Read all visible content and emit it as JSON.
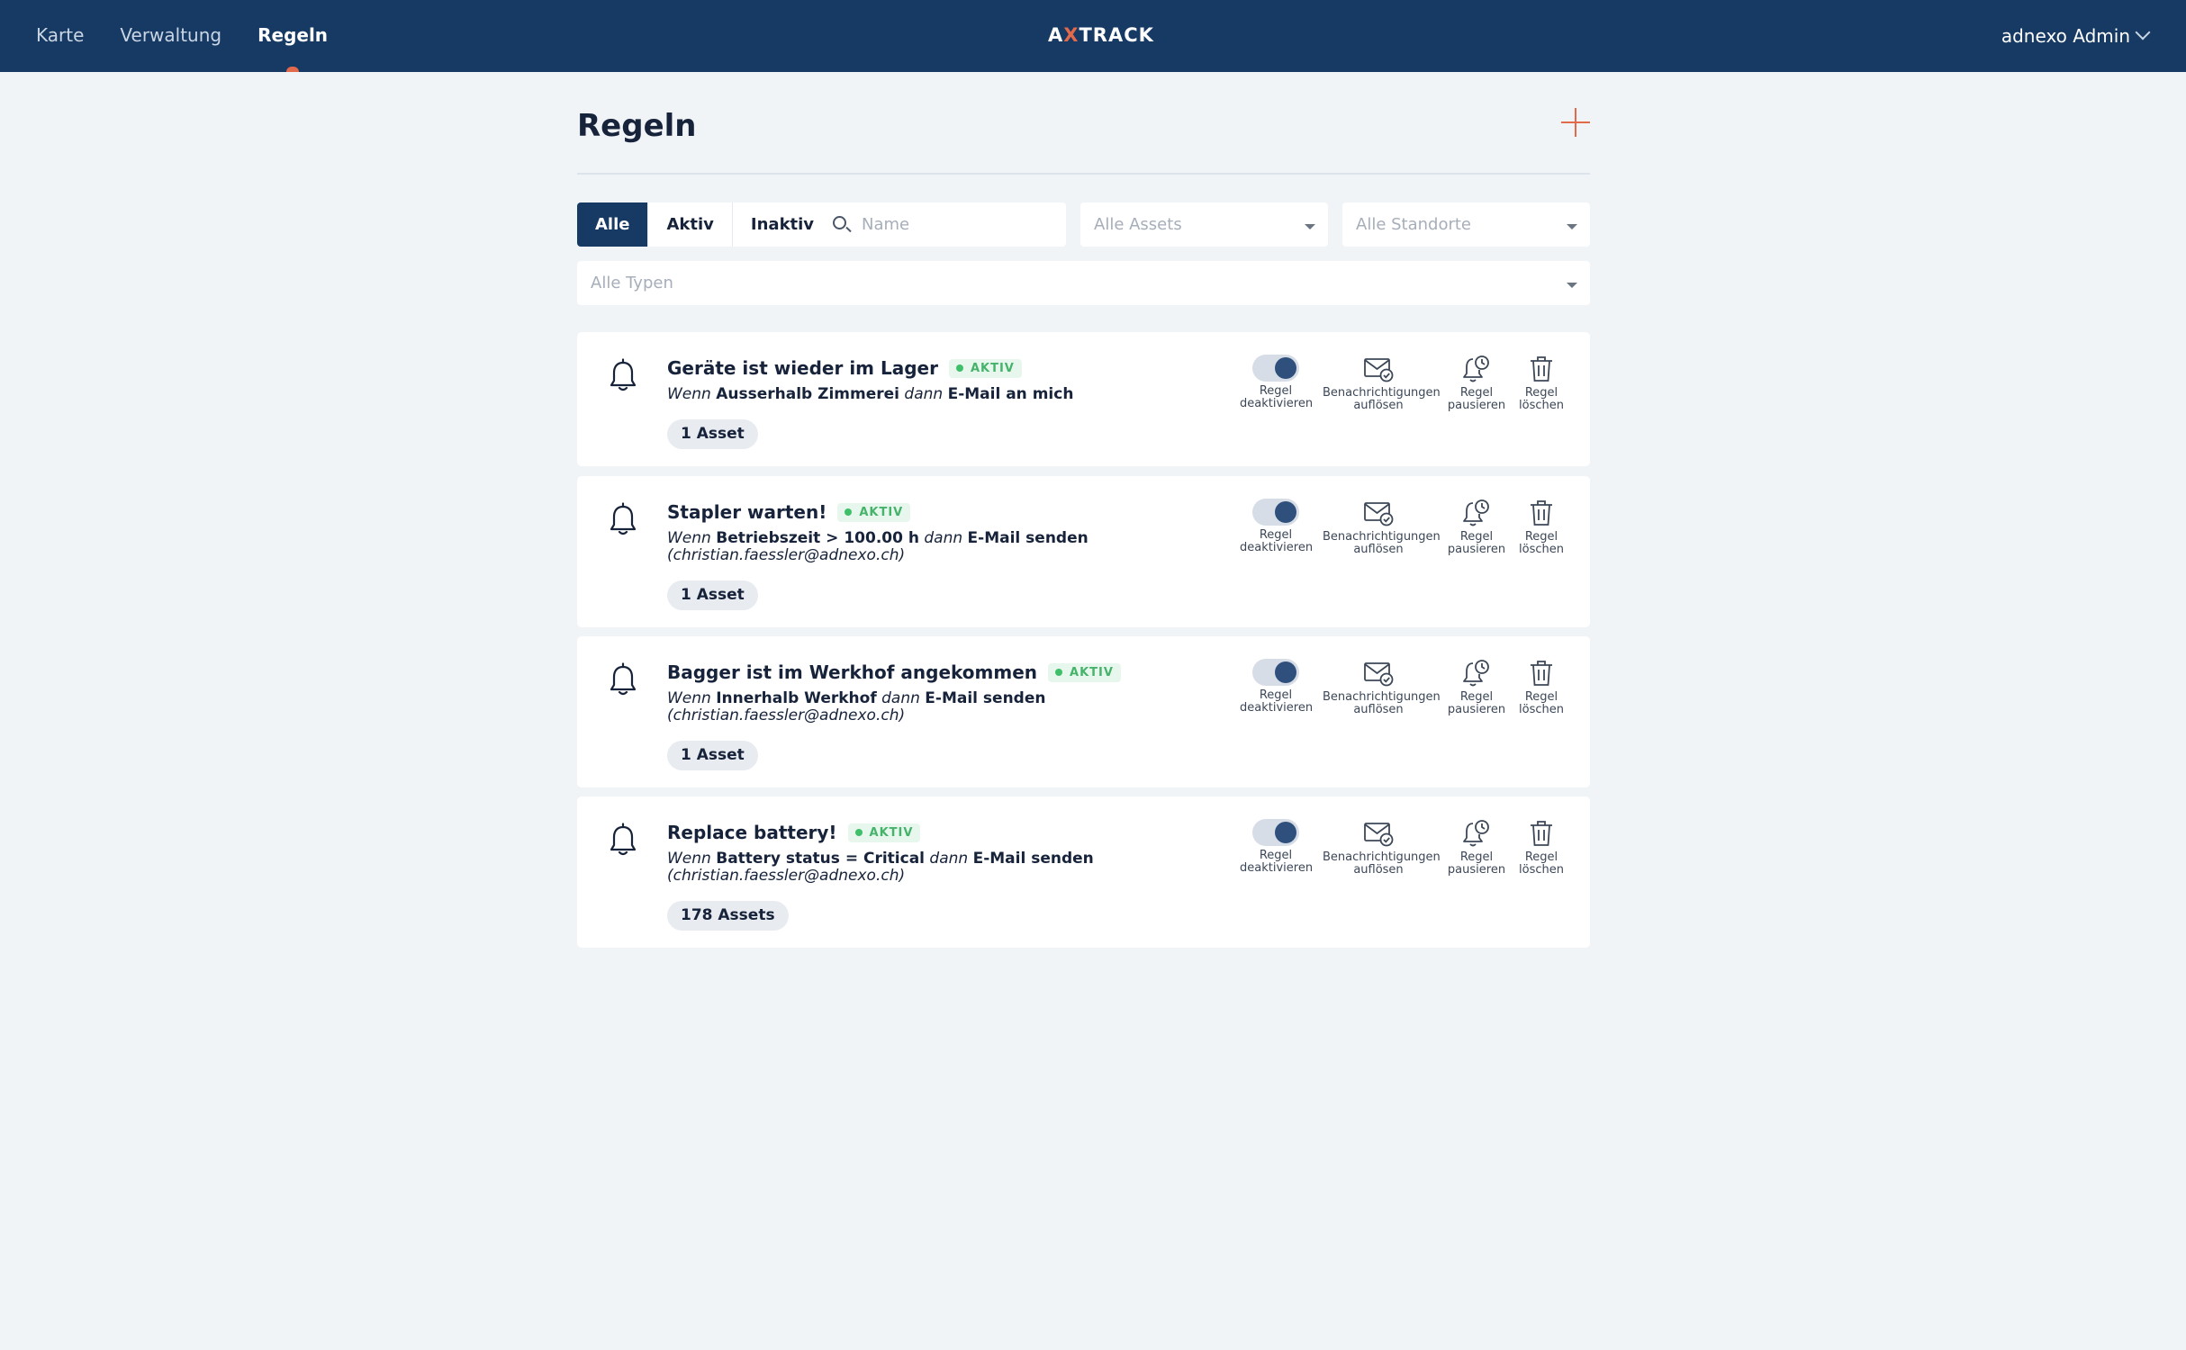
{
  "nav": {
    "items": [
      {
        "label": "Karte",
        "active": false
      },
      {
        "label": "Verwaltung",
        "active": false
      },
      {
        "label": "Regeln",
        "active": true
      }
    ],
    "logo": {
      "part1": "A",
      "part2": "X",
      "part3": "TRACK"
    },
    "user_label": "adnexo Admin"
  },
  "page": {
    "title": "Regeln",
    "filters": {
      "segments": [
        "Alle",
        "Aktiv",
        "Inaktiv"
      ],
      "active_segment": "Alle",
      "search_placeholder": "Name",
      "assets_placeholder": "Alle Assets",
      "standorte_placeholder": "Alle Standorte",
      "typen_placeholder": "Alle Typen"
    }
  },
  "rules": [
    {
      "name": "Geräte ist wieder im Lager",
      "status": "AKTIV",
      "wenn": "Wenn",
      "condition": "Ausserhalb Zimmerei",
      "dann": "dann",
      "action": "E-Mail an mich",
      "recipient": "",
      "assets": "1 Asset"
    },
    {
      "name": "Stapler warten!",
      "status": "AKTIV",
      "wenn": "Wenn",
      "condition": "Betriebszeit > 100.00 h",
      "dann": "dann",
      "action": "E-Mail senden",
      "recipient": "(christian.faessler@adnexo.ch)",
      "assets": "1 Asset"
    },
    {
      "name": "Bagger ist im Werkhof angekommen",
      "status": "AKTIV",
      "wenn": "Wenn",
      "condition": "Innerhalb Werkhof",
      "dann": "dann",
      "action": "E-Mail senden",
      "recipient": "(christian.faessler@adnexo.ch)",
      "assets": "1 Asset"
    },
    {
      "name": "Replace battery!",
      "status": "AKTIV",
      "wenn": "Wenn",
      "condition": "Battery status = Critical",
      "dann": "dann",
      "action": "E-Mail senden",
      "recipient": "(christian.faessler@adnexo.ch)",
      "assets": "178 Assets"
    }
  ],
  "actions": {
    "deactivate": {
      "line1": "Regel",
      "line2": "deaktivieren",
      "icon": "toggle-on-icon"
    },
    "resolve": {
      "line1": "Benachrichtigungen",
      "line2": "auflösen",
      "icon": "mail-check-icon"
    },
    "pause": {
      "line1": "Regel",
      "line2": "pausieren",
      "icon": "bell-clock-icon"
    },
    "delete": {
      "line1": "Regel",
      "line2": "löschen",
      "icon": "trash-icon"
    }
  },
  "colors": {
    "nav_bg": "#163a63",
    "accent": "#e26a4b",
    "status_green": "#3fbf6a",
    "page_bg": "#f1f4f7"
  }
}
